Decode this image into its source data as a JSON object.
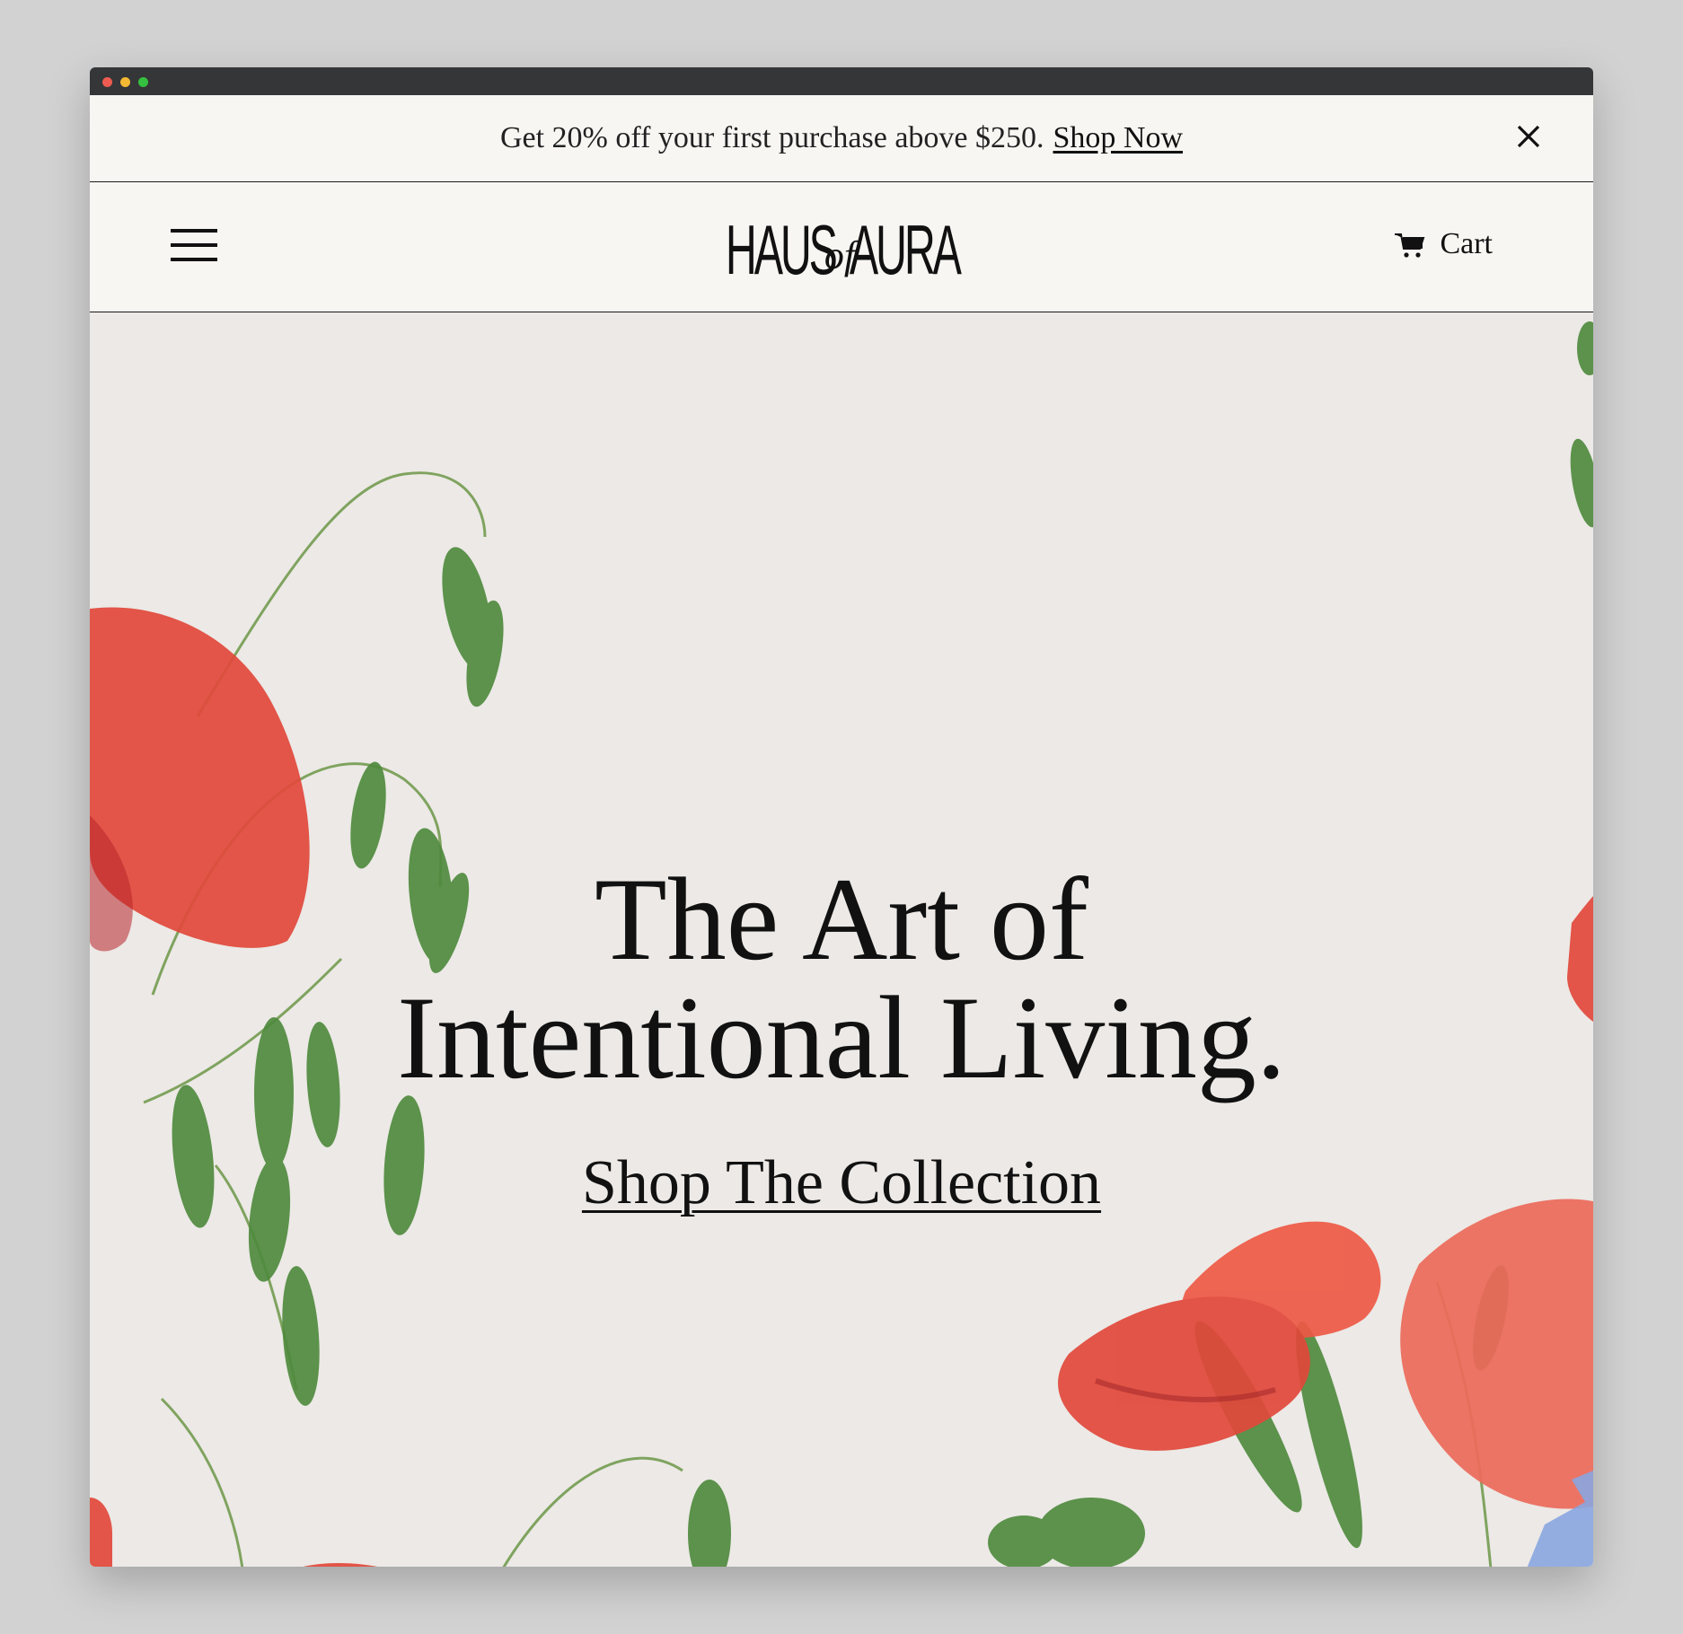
{
  "window": {
    "controls": [
      "close",
      "minimize",
      "maximize"
    ]
  },
  "announcement": {
    "text": "Get 20% off your first purchase above $250.",
    "link_label": "Shop Now",
    "close_icon": "close-icon"
  },
  "header": {
    "menu_icon": "hamburger-menu-icon",
    "logo": {
      "part1": "HAUS",
      "part2": "of",
      "part3": "AURA"
    },
    "cart_icon": "cart-icon",
    "cart_label": "Cart"
  },
  "hero": {
    "headline_line1": "The Art of",
    "headline_line2": "Intentional Living.",
    "cta_label": "Shop The Collection",
    "illustration": "watercolor-poppies-and-oat-grass"
  },
  "colors": {
    "page_bg": "#d2d2d2",
    "chrome_bar": "#353638",
    "banner_bg": "#f7f6f3",
    "hero_bg": "#ece9e6",
    "poppy_red": "#e04a3c",
    "leaf_green": "#4e8a3d",
    "text": "#111111"
  }
}
